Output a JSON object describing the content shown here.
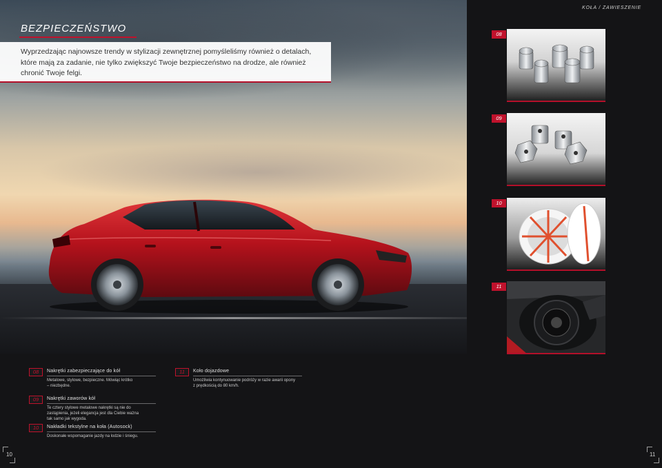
{
  "header": {
    "section_label": "KOŁA / ZAWIESZENIE",
    "title": "BEZPIECZEŃSTWO"
  },
  "intro": {
    "text": "Wyprzedzając najnowsze trendy w stylizacji zewnętrznej pomyśleliśmy również o detalach, które mają za zadanie, nie tylko zwiększyć Twoje bezpieczeństwo na drodze, ale również chronić Twoje felgi."
  },
  "thumbs": [
    {
      "number": "08",
      "icon": "wheel-lock-nuts"
    },
    {
      "number": "09",
      "icon": "valve-caps"
    },
    {
      "number": "10",
      "icon": "autosock"
    },
    {
      "number": "11",
      "icon": "spare-wheel"
    }
  ],
  "items": [
    {
      "number": "08",
      "title": "Nakrętki zabezpieczające do kół",
      "text_lines": [
        "Metalowe, stylowe, bezpieczne. Mówiąc krótko",
        "– niezbędne."
      ]
    },
    {
      "number": "11",
      "title": "Koło dojazdowe",
      "text_lines": [
        "Umożliwia kontynuowanie podróży w razie awarii opony",
        "z prędkością do 80 km/h."
      ]
    },
    {
      "number": "09",
      "title": "Nakrętki zaworów kół",
      "text_lines": [
        "Te cztery stylowe metalowe nakrętki są nie do",
        "zastąpienia, jeżeli elegancja jest dla Ciebie ważna",
        "tak samo jak wygoda."
      ]
    },
    {
      "number": "10",
      "title": "Nakładki tekstylne na koła (Autosock)",
      "text_lines": [
        "Doskonałe wspomaganie jazdy na lodzie i śniegu."
      ]
    }
  ],
  "pages": {
    "left": "10",
    "right": "11"
  },
  "colors": {
    "accent": "#c0122c",
    "background": "#141416"
  }
}
